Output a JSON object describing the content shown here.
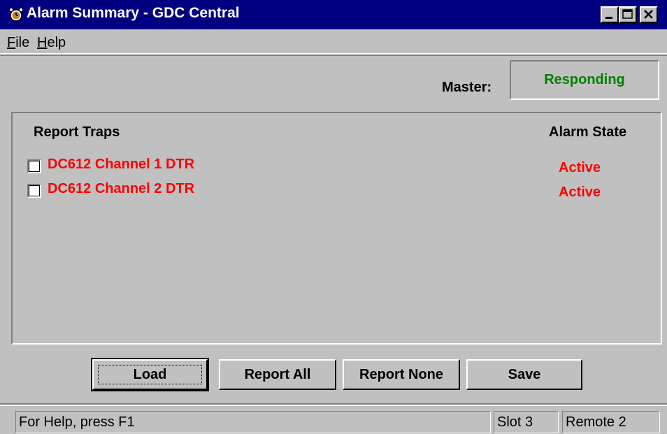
{
  "window": {
    "title": "Alarm Summary - GDC Central",
    "icon": "alarm-clock-icon",
    "controls": [
      "minimize",
      "maximize",
      "close"
    ]
  },
  "menu": {
    "items": [
      {
        "label": "File"
      },
      {
        "label": "Help"
      }
    ]
  },
  "master": {
    "label": "Master:",
    "value": "Responding",
    "value_color": "#008000"
  },
  "traps": {
    "header_traps": "Report Traps",
    "header_state": "Alarm State",
    "rows": [
      {
        "name": "DC612 Channel 1 DTR",
        "state": "Active",
        "checked": false
      },
      {
        "name": "DC612 Channel 2 DTR",
        "state": "Active",
        "checked": false
      }
    ],
    "alarm_color": "#ff0000"
  },
  "buttons": {
    "load": "Load",
    "report_all": "Report All",
    "report_none": "Report None",
    "save": "Save"
  },
  "status": {
    "help": "For Help, press F1",
    "slot": "Slot 3",
    "remote": "Remote 2"
  }
}
